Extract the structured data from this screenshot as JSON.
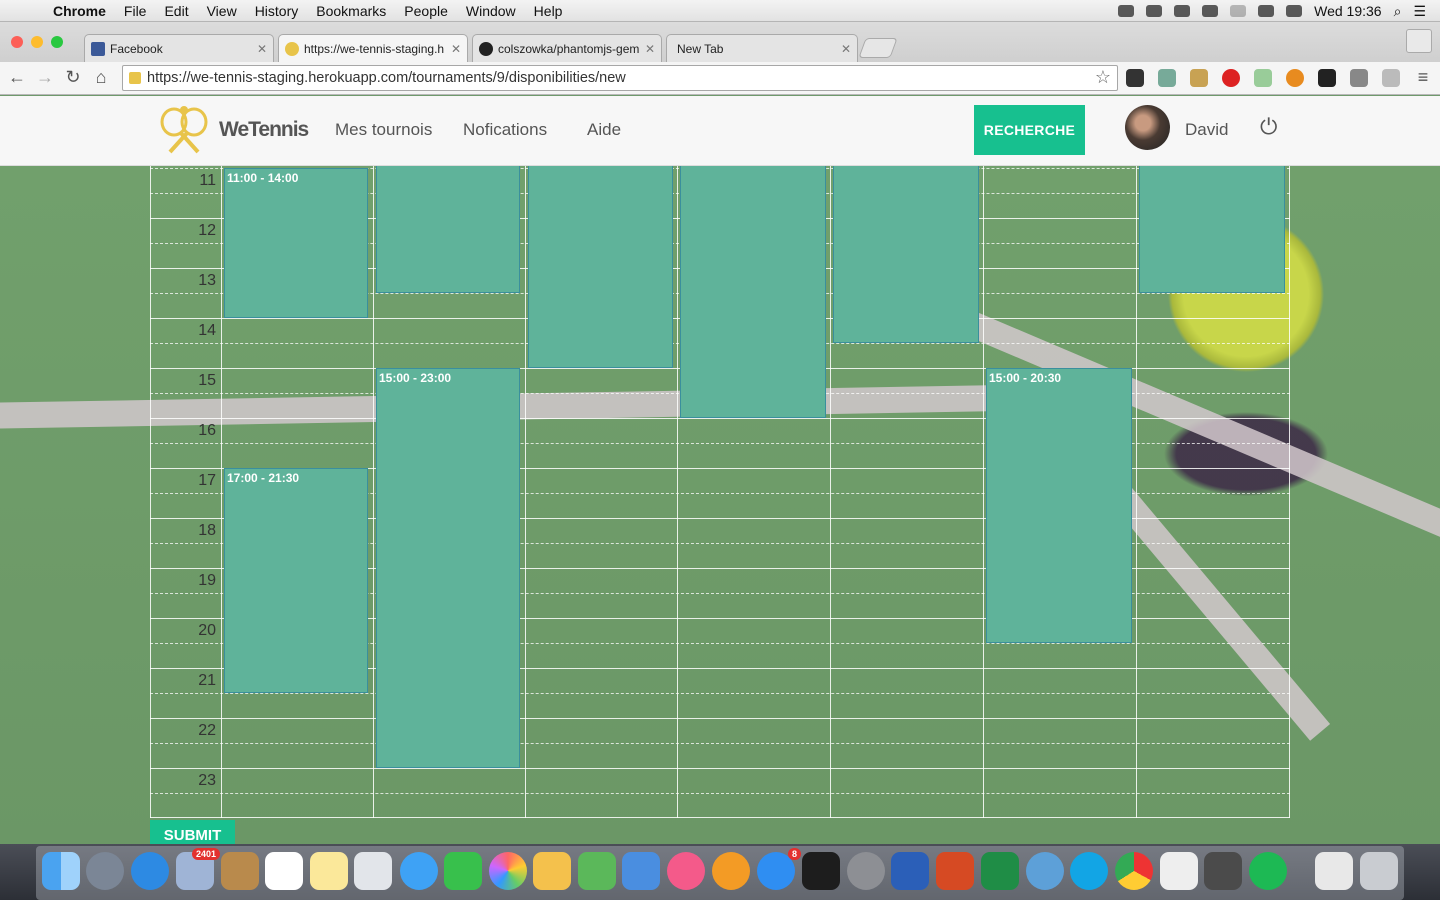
{
  "menubar": {
    "items": [
      "Chrome",
      "File",
      "Edit",
      "View",
      "History",
      "Bookmarks",
      "People",
      "Window",
      "Help"
    ],
    "clock": "Wed 19:36"
  },
  "tabs": [
    {
      "label": "Facebook",
      "color": "#3b5998"
    },
    {
      "label": "https://we-tennis-staging.h",
      "color": "#e8c44a"
    },
    {
      "label": "colszowka/phantomjs-gem",
      "color": "#222222"
    },
    {
      "label": "New Tab",
      "color": "#e4e4e4"
    }
  ],
  "address": {
    "url": "https://we-tennis-staging.herokuapp.com/tournaments/9/disponibilities/new"
  },
  "site": {
    "logo": "WeTennis",
    "nav": [
      "Mes tournois",
      "Nofications",
      "Aide"
    ],
    "search_label": "RECHERCHE",
    "user": "David",
    "accent": "#17c08f"
  },
  "calendar": {
    "hours": [
      "11",
      "12",
      "13",
      "14",
      "15",
      "16",
      "17",
      "18",
      "19",
      "20",
      "21",
      "22",
      "23"
    ],
    "events": [
      {
        "label": "11:00 - 14:00"
      },
      {
        "label": "17:00 - 21:30"
      },
      {
        "label": ""
      },
      {
        "label": "15:00 - 23:00"
      },
      {
        "label": ""
      },
      {
        "label": ""
      },
      {
        "label": ""
      },
      {
        "label": "15:00 - 20:30"
      },
      {
        "label": ""
      }
    ],
    "event_color": "#5fb39a"
  },
  "submit_label": "SUBMIT",
  "dock": {
    "badges": [
      "2401",
      "8"
    ]
  }
}
